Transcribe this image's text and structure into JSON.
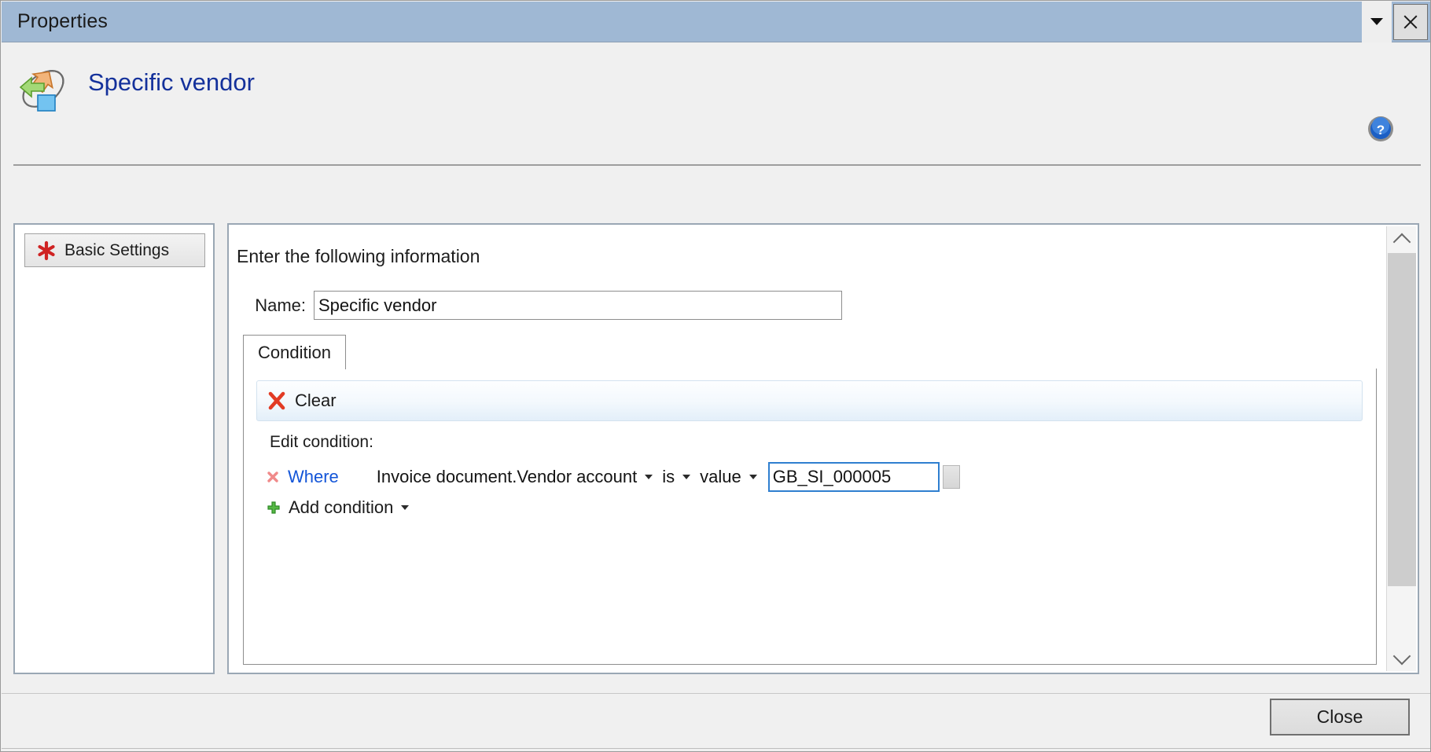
{
  "window": {
    "title": "Properties",
    "dropdown_icon": "chevron-down-icon",
    "close_icon": "close-icon"
  },
  "header": {
    "title": "Specific vendor",
    "icon": "workflow-routing-icon",
    "help_icon": "help-question-icon"
  },
  "sidebar": {
    "items": [
      {
        "label": "Basic Settings",
        "icon": "red-asterisk-icon"
      }
    ]
  },
  "main": {
    "intro": "Enter the following information",
    "name_label": "Name:",
    "name_value": "Specific vendor",
    "name_placeholder": "",
    "tabs": [
      {
        "label": "Condition",
        "selected": true
      }
    ],
    "toolbar": {
      "clear_label": "Clear",
      "clear_icon": "red-x-icon"
    },
    "edit_condition_label": "Edit condition:",
    "condition_row": {
      "delete_icon": "delete-condition-icon",
      "where_label": "Where",
      "field": "Invoice document.Vendor account",
      "field_caret": "caret-down-icon",
      "operator": "is",
      "operator_caret": "caret-down-icon",
      "value_type": "value",
      "value_type_caret": "caret-down-icon",
      "value": "GB_SI_000005",
      "value_placeholder": "",
      "lookup_icon": "lookup-button-icon"
    },
    "add_condition": {
      "label": "Add condition",
      "icon": "green-plus-icon",
      "caret": "caret-down-icon"
    },
    "scrollbar": {
      "up_icon": "chevron-up-icon",
      "down_icon": "chevron-down-icon"
    }
  },
  "footer": {
    "close_label": "Close"
  },
  "colors": {
    "titlebar": "#9fb8d4",
    "header_title": "#14319b",
    "link": "#1355d8",
    "focus_border": "#2f7fd0",
    "panel_border": "#9aa7b4",
    "background": "#f0f0f0"
  }
}
